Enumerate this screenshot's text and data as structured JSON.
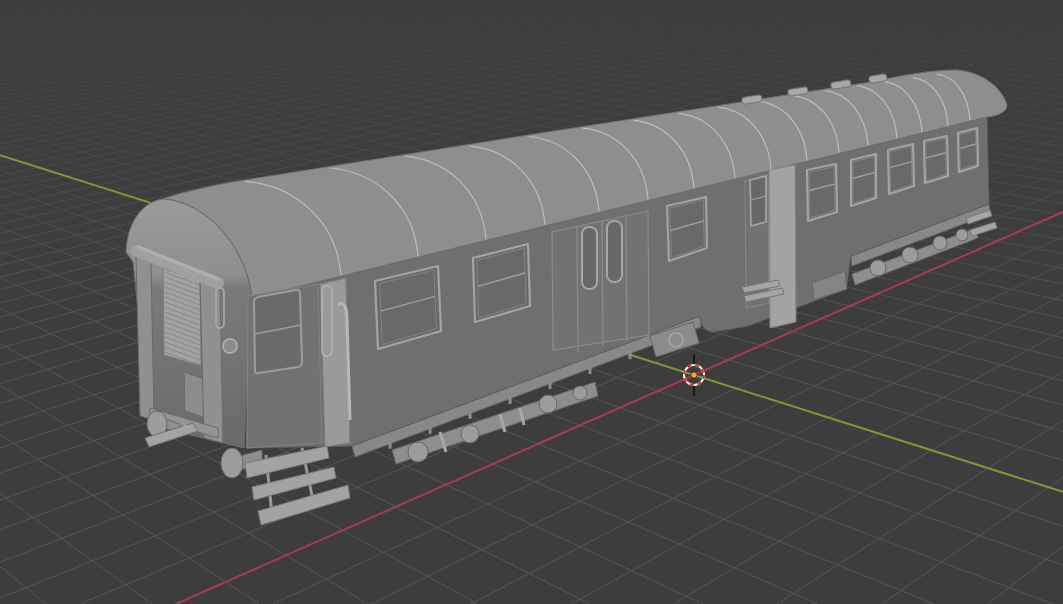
{
  "viewport": {
    "overlays": {
      "floor_grid": true,
      "x_axis": true,
      "y_axis": true,
      "cursor_3d": true,
      "object_origin": true
    }
  }
}
